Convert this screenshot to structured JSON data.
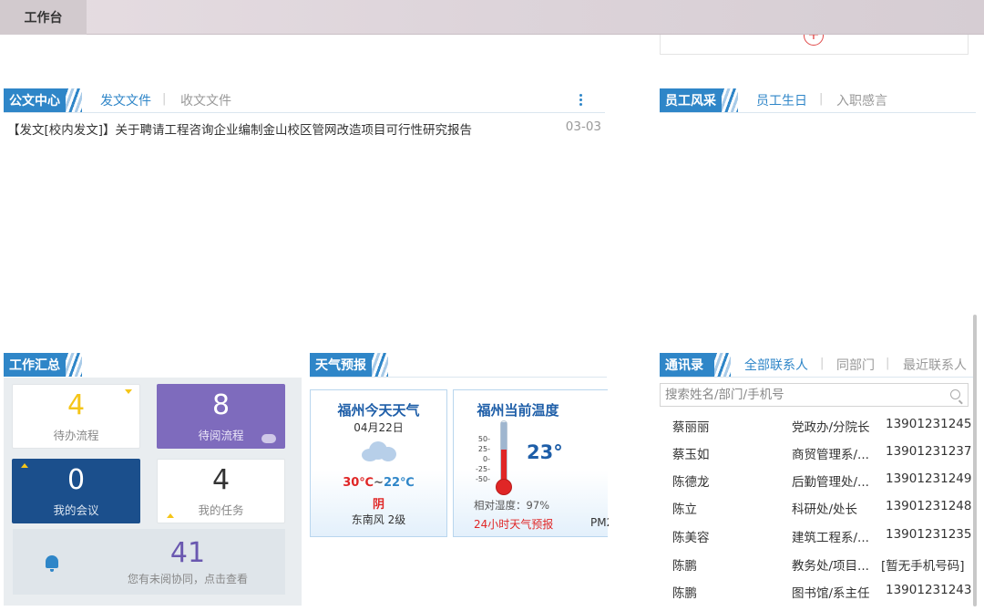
{
  "topbar": {
    "tab_label": "工作台"
  },
  "doc_center": {
    "title": "公文中心",
    "tabs": [
      "发文文件",
      "收文文件"
    ],
    "items": [
      {
        "text": "【发文[校内发文]】关于聘请工程咨询企业编制金山校区管网改造项目可行性研究报告",
        "date": "03-03"
      }
    ]
  },
  "staff": {
    "title": "员工风采",
    "tabs": [
      "员工生日",
      "入职感言"
    ]
  },
  "work_summary": {
    "title": "工作汇总",
    "tiles": [
      {
        "value": "4",
        "label": "待办流程"
      },
      {
        "value": "8",
        "label": "待阅流程"
      },
      {
        "value": "0",
        "label": "我的会议"
      },
      {
        "value": "4",
        "label": "我的任务"
      }
    ],
    "unread": {
      "value": "41",
      "label": "您有未阅协同，点击查看"
    }
  },
  "weather": {
    "title": "天气预报",
    "today": {
      "title": "福州今天天气",
      "date": "04月22日",
      "temp_high": "30℃",
      "sep": "~",
      "temp_low": "22℃",
      "condition": "阴",
      "wind": "东南风 2级"
    },
    "current": {
      "title": "福州当前温度",
      "temperature": "23°",
      "humidity": "相对湿度：97%",
      "forecast_link": "24小时天气预报",
      "pm": "PM2",
      "scale": [
        "50-",
        "25-",
        "0-",
        "-25-",
        "-50-"
      ]
    }
  },
  "contacts": {
    "title": "通讯录",
    "tabs": [
      "全部联系人",
      "同部门",
      "最近联系人"
    ],
    "search_placeholder": "搜索姓名/部门/手机号",
    "rows": [
      {
        "name": "蔡丽丽",
        "dept": "党政办/分院长",
        "phone": "13901231245"
      },
      {
        "name": "蔡玉如",
        "dept": "商贸管理系/...",
        "phone": "13901231237"
      },
      {
        "name": "陈德龙",
        "dept": "后勤管理处/...",
        "phone": "13901231249"
      },
      {
        "name": "陈立",
        "dept": "科研处/处长",
        "phone": "13901231248"
      },
      {
        "name": "陈美容",
        "dept": "建筑工程系/...",
        "phone": "13901231235"
      },
      {
        "name": "陈鹏",
        "dept": "教务处/项目...",
        "phone": "[暂无手机号码]"
      },
      {
        "name": "陈鹏",
        "dept": "图书馆/系主任",
        "phone": "13901231243"
      }
    ]
  }
}
